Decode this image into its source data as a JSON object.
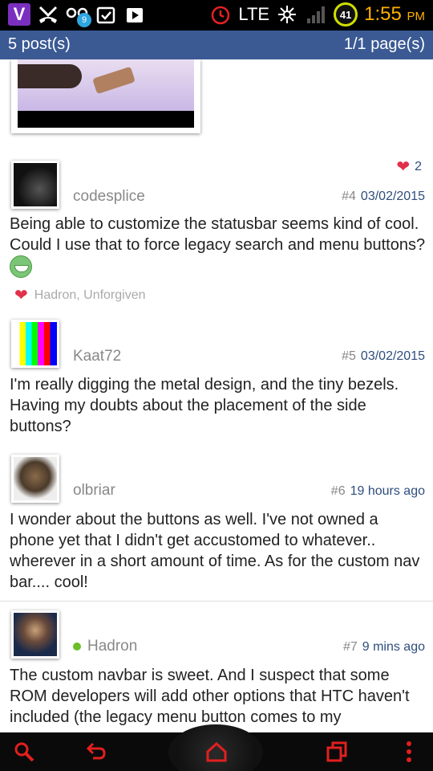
{
  "status_bar": {
    "time": "1:55",
    "ampm": "PM",
    "network": "LTE",
    "battery": "41",
    "notification_count": "9"
  },
  "header": {
    "posts_count": "5 post(s)",
    "pages": "1/1 page(s)"
  },
  "posts": [
    {
      "username": "codesplice",
      "number": "#4",
      "date": "03/02/2015",
      "likes_count": "2",
      "body": "Being able to customize the statusbar seems kind of cool. Could I use that to force legacy search and menu buttons?",
      "liked_by": "Hadron, Unforgiven"
    },
    {
      "username": "Kaat72",
      "number": "#5",
      "date": "03/02/2015",
      "body": "I'm really digging the metal design, and the tiny bezels. Having my doubts about the placement of the side buttons?"
    },
    {
      "username": "olbriar",
      "number": "#6",
      "date": "19 hours ago",
      "body": "I wonder about the buttons as well. I've not owned a phone yet that I didn't get accustomed to whatever.. wherever in a short amount of time. As for the custom nav bar.... cool!"
    },
    {
      "username": "Hadron",
      "number": "#7",
      "date": "9 mins ago",
      "body": "The custom navbar is sweet. And I suspect that some ROM developers will add other options that HTC haven't included (the legacy menu button comes to my"
    }
  ],
  "colors": {
    "header_bg": "#3b5a94",
    "link": "#2e4d7d",
    "nav_icons": "#e21f1f",
    "clock": "#ffb000"
  },
  "navbar": {
    "icons": [
      "search-icon",
      "back-icon",
      "home-icon",
      "recents-icon",
      "menu-icon"
    ]
  }
}
